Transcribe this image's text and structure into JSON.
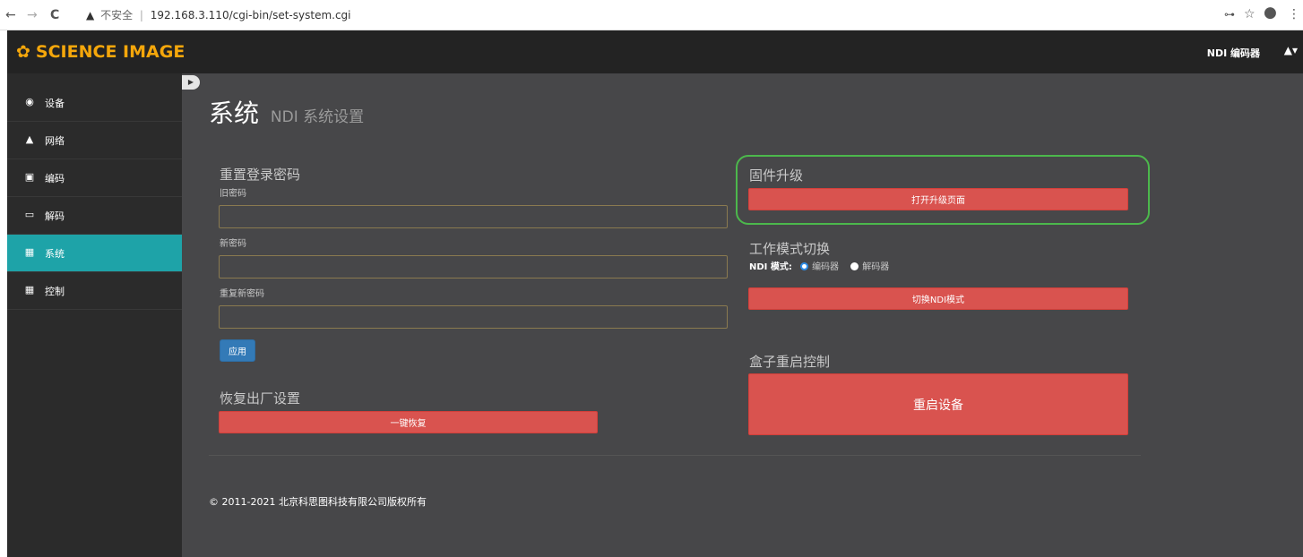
{
  "browser": {
    "back": "←",
    "forward": "→",
    "reload": "C",
    "warn_glyph": "▲",
    "insecure": "不安全",
    "separator": "|",
    "url": "192.168.3.110/cgi-bin/set-system.cgi",
    "key_icon": "⊶",
    "star_icon": "☆",
    "profile_icon": "●",
    "menu_icon": "⋮"
  },
  "topbar": {
    "brand": "SCIENCE IMAGE",
    "brand_icon": "✿",
    "device": "NDI 编码器",
    "user_icon": "▲▾"
  },
  "sidebar": {
    "items": [
      {
        "icon": "◉",
        "label": "设备"
      },
      {
        "icon": "▲",
        "label": "网络"
      },
      {
        "icon": "▣",
        "label": "编码"
      },
      {
        "icon": "▭",
        "label": "解码"
      },
      {
        "icon": "▦",
        "label": "系统"
      },
      {
        "icon": "▦",
        "label": "控制"
      }
    ],
    "active_index": 4
  },
  "collapse_icon": "▶",
  "page": {
    "title": "系统",
    "subtitle": "NDI 系统设置"
  },
  "password": {
    "heading": "重置登录密码",
    "old_label": "旧密码",
    "new_label": "新密码",
    "repeat_label": "重复新密码",
    "apply": "应用"
  },
  "factory": {
    "heading": "恢复出厂设置",
    "button": "一键恢复"
  },
  "firmware": {
    "heading": "固件升级",
    "button": "打开升级页面"
  },
  "workmode": {
    "heading": "工作模式切换",
    "label": "NDI 模式:",
    "option_encoder": "编码器",
    "option_decoder": "解码器",
    "selected": "编码器",
    "button": "切换NDI模式"
  },
  "reboot": {
    "heading": "盒子重启控制",
    "button": "重启设备"
  },
  "footer": "© 2011-2021 北京科思图科技有限公司版权所有",
  "colors": {
    "brand": "#f5a70b",
    "active": "#1ea3a8",
    "danger": "#d9534f",
    "primary": "#337ab7",
    "highlight": "#4cb84c"
  }
}
